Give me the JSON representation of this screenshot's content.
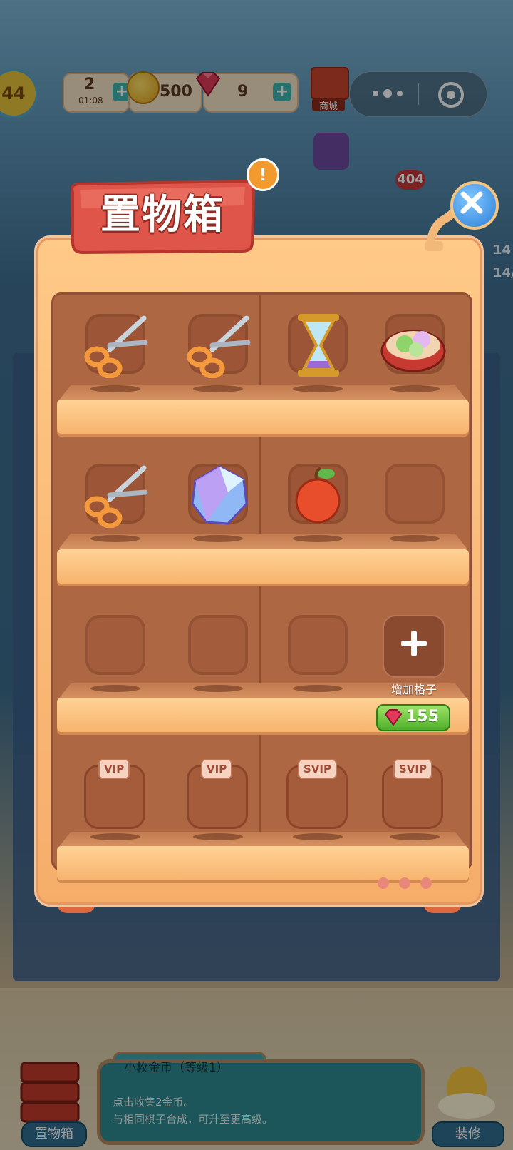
{
  "hud": {
    "level": "44",
    "energy": "2",
    "energy_timer": "01:08",
    "coins": "500",
    "gems": "9",
    "shop_label": "商城"
  },
  "side": {
    "badge_count": "404",
    "right_top": "14",
    "right_mid": "14/"
  },
  "storage": {
    "title": "置物箱",
    "alert": "!",
    "slots": [
      {
        "item": "scissors-icon"
      },
      {
        "item": "scissors-icon"
      },
      {
        "item": "hourglass-icon"
      },
      {
        "item": "flower-cake-plate-icon"
      },
      {
        "item": "scissors-icon"
      },
      {
        "item": "crystal-gem-icon"
      },
      {
        "item": "apple-icon"
      },
      {
        "item": "empty"
      },
      {
        "item": "empty"
      },
      {
        "item": "empty"
      },
      {
        "item": "empty"
      }
    ],
    "add_slot_label": "增加格子",
    "add_slot_price": "155",
    "locked": [
      {
        "tag": "VIP"
      },
      {
        "tag": "VIP"
      },
      {
        "tag": "SVIP"
      },
      {
        "tag": "SVIP"
      }
    ],
    "page_count": 3
  },
  "info": {
    "title": "小枚金币（等级1）",
    "line1": "点击收集2金币。",
    "line2": "与相同棋子合成，可升至更高级。"
  },
  "bottom": {
    "left_label": "置物箱",
    "right_label": "装修"
  },
  "colors": {
    "cabinet": "#f6ad6a",
    "shelf_inner": "#ad6742",
    "price_green": "#4fb02a",
    "title_red": "#e0554a"
  }
}
